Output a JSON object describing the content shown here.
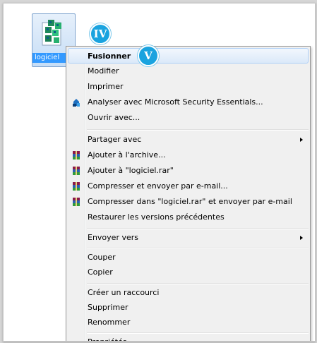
{
  "desktop": {
    "file_name": "logiciel",
    "badge_iv": "IV",
    "badge_v": "V"
  },
  "context_menu": {
    "items": [
      {
        "label": "Fusionner",
        "bold": true,
        "hover": true
      },
      {
        "label": "Modifier"
      },
      {
        "label": "Imprimer"
      },
      {
        "label": "Analyser avec Microsoft Security Essentials...",
        "icon": "security-essentials-icon"
      },
      {
        "label": "Ouvrir avec..."
      },
      {
        "label": "Partager avec",
        "submenu": true
      },
      {
        "label": "Ajouter à l'archive...",
        "icon": "winrar-icon"
      },
      {
        "label": "Ajouter à \"logiciel.rar\"",
        "icon": "winrar-icon"
      },
      {
        "label": "Compresser et envoyer par e-mail...",
        "icon": "winrar-icon"
      },
      {
        "label": "Compresser dans \"logiciel.rar\" et envoyer par e-mail",
        "icon": "winrar-icon"
      },
      {
        "label": "Restaurer les versions précédentes"
      },
      {
        "label": "Envoyer vers",
        "submenu": true
      },
      {
        "label": "Couper"
      },
      {
        "label": "Copier"
      },
      {
        "label": "Créer un raccourci"
      },
      {
        "label": "Supprimer"
      },
      {
        "label": "Renommer"
      },
      {
        "label": "Propriétés"
      }
    ]
  },
  "colors": {
    "badge": "#1aa3df",
    "selection": "#3399ff",
    "hover_border": "#aecff7"
  }
}
